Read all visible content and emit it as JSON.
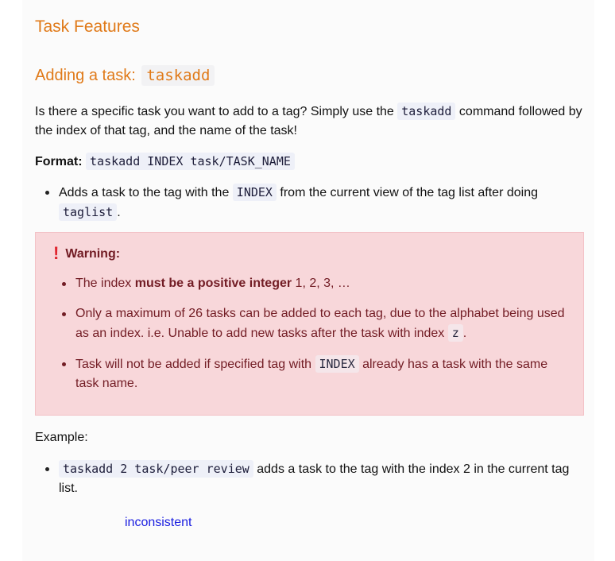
{
  "section_title": "Task Features",
  "subsection": {
    "title_text": "Adding a task: ",
    "title_code": "taskadd"
  },
  "intro": {
    "part1": "Is there a specific task you want to add to a tag? Simply use the ",
    "code": "taskadd",
    "part2": " command followed by the index of that tag, and the name of the task!"
  },
  "format": {
    "label": "Format:",
    "code": "taskadd INDEX task/TASK_NAME"
  },
  "format_bullets": [
    {
      "part1": "Adds a task to the tag with the ",
      "code1": "INDEX",
      "part2": " from the current view of the tag list after doing ",
      "code2": "taglist",
      "part3": "."
    }
  ],
  "warning": {
    "icon": "exclamation-icon",
    "title": "Warning:",
    "items": [
      {
        "part1": "The index ",
        "bold": "must be a positive integer",
        "part2": " 1, 2, 3, …"
      },
      {
        "part1": "Only a maximum of 26 tasks can be added to each tag, due to the alphabet being used as an index. i.e. Unable to add new tasks after the task with index ",
        "code": "z",
        "part2": "."
      },
      {
        "part1": "Task will not be added if specified tag with ",
        "code": "INDEX",
        "part2": " already has a task with the same task name."
      }
    ],
    "colors": {
      "background": "#f8d7da",
      "text": "#721c24",
      "icon": "#e0262f"
    }
  },
  "example": {
    "label": "Example:",
    "items": [
      {
        "code": "taskadd 2 task/peer review",
        "text": " adds a task to the tag with the index 2 in the current tag list."
      }
    ]
  },
  "link_text": "inconsistent",
  "colors": {
    "heading": "#e07a19",
    "link": "#1a1ee0"
  }
}
